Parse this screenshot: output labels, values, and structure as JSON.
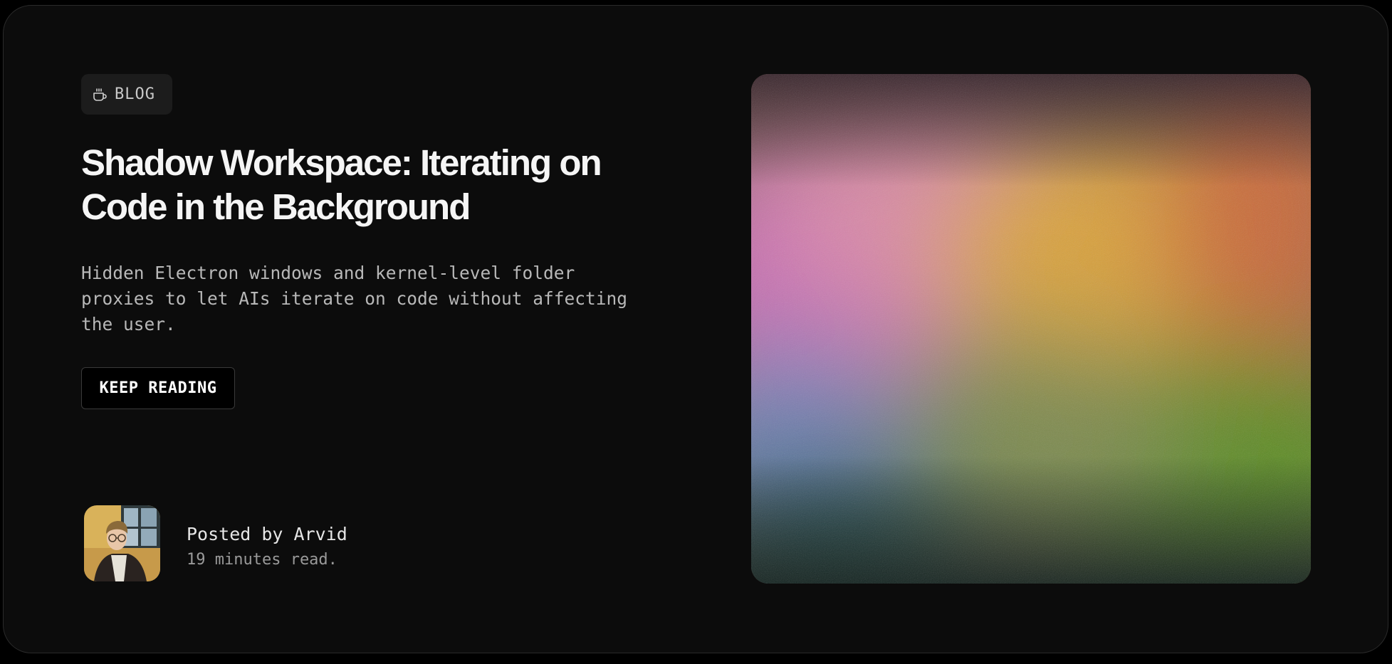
{
  "badge": {
    "label": "BLOG",
    "icon": "coffee-cup-icon"
  },
  "post": {
    "title": "Shadow Workspace: Iterating on Code in the Background",
    "description": "Hidden Electron windows and kernel-level folder proxies to let AIs iterate on code without affecting the user.",
    "cta_label": "KEEP READING"
  },
  "author": {
    "posted_by": "Posted by Arvid",
    "read_time": "19 minutes read."
  },
  "colors": {
    "background": "#0c0c0c",
    "text_primary": "#f5f5f5",
    "text_secondary": "#b8b8b8",
    "gradient_pink": "#c76fb0",
    "gradient_orange": "#d99a3a",
    "gradient_green": "#5a8a2a",
    "gradient_blue": "#6f86b8"
  }
}
